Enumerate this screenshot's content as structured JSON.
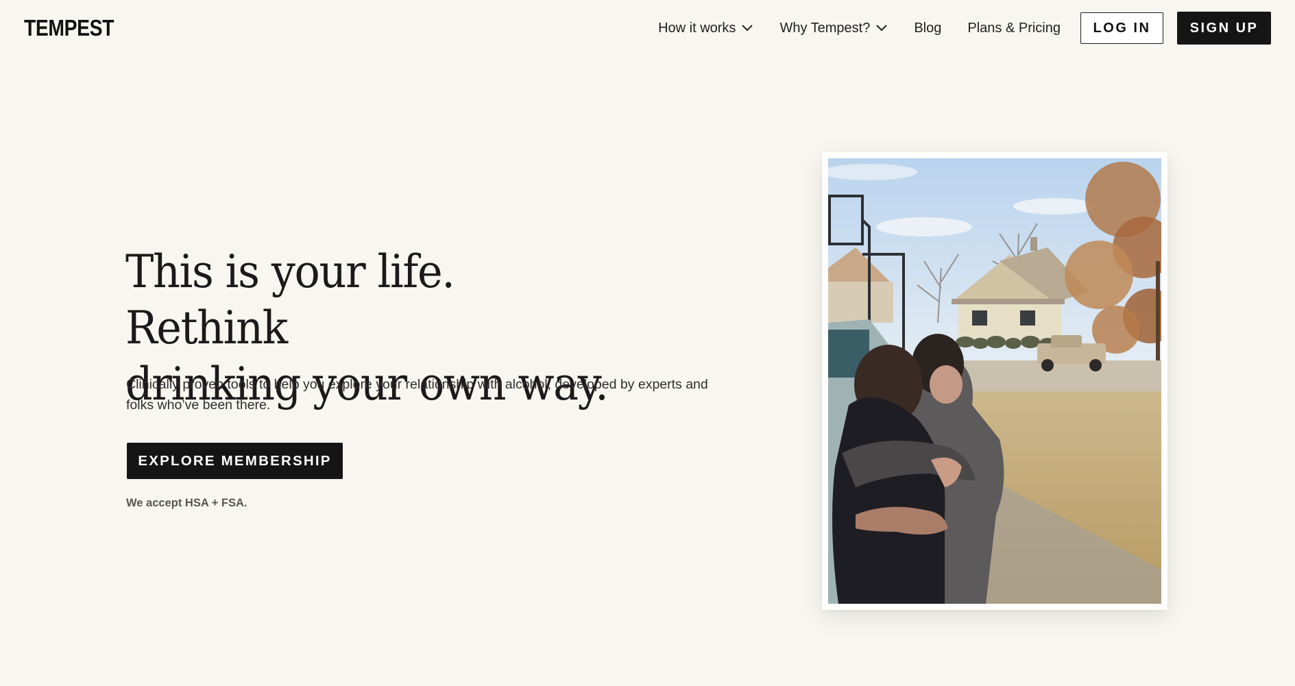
{
  "brand": {
    "logo_text": "TEMPEST"
  },
  "nav": {
    "items": [
      {
        "label": "How it works",
        "has_dropdown": true
      },
      {
        "label": "Why Tempest?",
        "has_dropdown": true
      },
      {
        "label": "Blog",
        "has_dropdown": false
      },
      {
        "label": "Plans & Pricing",
        "has_dropdown": false
      }
    ],
    "login_label": "LOG IN",
    "signup_label": "SIGN UP"
  },
  "hero": {
    "heading_line1": "This is your life. Rethink",
    "heading_line2": "drinking your own way.",
    "subtitle_line1": "Clinically proven tools to help you explore your relationship with alcohol, developed by experts and",
    "subtitle_line2": "folks who’ve been there.",
    "cta_label": "EXPLORE MEMBERSHIP",
    "payment_note": "We accept HSA + FSA."
  },
  "photo": {
    "icon": "hero-photo-two-people-hugging"
  },
  "colors": {
    "background": "#f8f6f0",
    "primary_dark": "#151515",
    "text": "#1a1a1a",
    "muted": "#555555"
  }
}
